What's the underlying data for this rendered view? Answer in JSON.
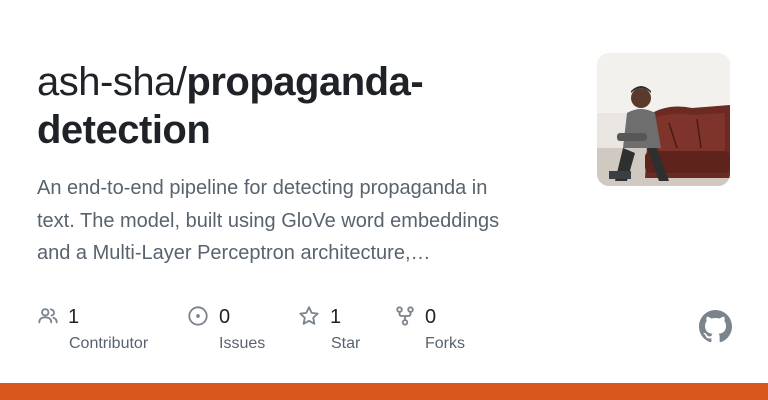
{
  "repo": {
    "owner": "ash-sha/",
    "name_line1": "propaganda-",
    "name_line2": "detection",
    "description_lines": [
      "An end-to-end pipeline for detecting propaganda in",
      "text. The model, built using GloVe word embeddings",
      "and a Multi-Layer Perceptron architecture,…"
    ]
  },
  "stats": [
    {
      "icon": "people-icon",
      "count": "1",
      "label": "Contributor"
    },
    {
      "icon": "issue-icon",
      "count": "0",
      "label": "Issues"
    },
    {
      "icon": "star-icon",
      "count": "1",
      "label": "Star"
    },
    {
      "icon": "fork-icon",
      "count": "0",
      "label": "Forks"
    }
  ],
  "colors": {
    "accent_bar": "#d9571c",
    "text_primary": "#1f2328",
    "text_muted": "#59636e",
    "icon_gray": "#7b838c"
  },
  "avatar": {
    "icon": "user-photo"
  },
  "brand_icon": "github-icon"
}
